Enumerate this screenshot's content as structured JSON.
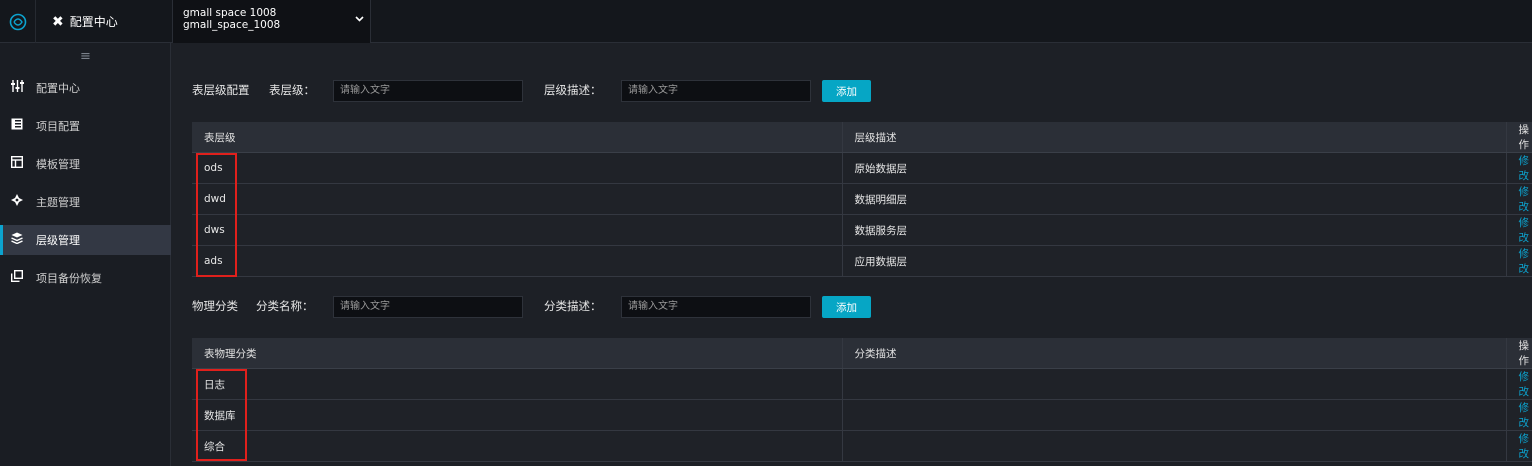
{
  "header": {
    "app_title": "配置中心",
    "space_name_display": "gmall space 1008",
    "space_name_id": "gmall_space_1008"
  },
  "sidebar": {
    "items": [
      {
        "label": "配置中心",
        "icon": "sliders-icon"
      },
      {
        "label": "项目配置",
        "icon": "book-icon"
      },
      {
        "label": "模板管理",
        "icon": "template-icon"
      },
      {
        "label": "主题管理",
        "icon": "compass-icon"
      },
      {
        "label": "层级管理",
        "icon": "layers-icon",
        "active": true
      },
      {
        "label": "项目备份恢复",
        "icon": "copy-icon"
      }
    ]
  },
  "layer_form": {
    "section_label": "表层级配置",
    "field1_label": "表层级：",
    "field1_placeholder": "请输入文字",
    "field2_label": "层级描述：",
    "field2_placeholder": "请输入文字",
    "add_label": "添加"
  },
  "layer_table": {
    "headers": [
      "表层级",
      "层级描述",
      "操作"
    ],
    "rows": [
      {
        "level": "ods",
        "desc": "原始数据层",
        "op": "修改"
      },
      {
        "level": "dwd",
        "desc": "数据明细层",
        "op": "修改"
      },
      {
        "level": "dws",
        "desc": "数据服务层",
        "op": "修改"
      },
      {
        "level": "ads",
        "desc": "应用数据层",
        "op": "修改"
      }
    ]
  },
  "category_form": {
    "section_label": "物理分类",
    "field1_label": "分类名称：",
    "field1_placeholder": "请输入文字",
    "field2_label": "分类描述：",
    "field2_placeholder": "请输入文字",
    "add_label": "添加"
  },
  "category_table": {
    "headers": [
      "表物理分类",
      "分类描述",
      "操作"
    ],
    "rows": [
      {
        "name": "日志",
        "desc": "",
        "op": "修改"
      },
      {
        "name": "数据库",
        "desc": "",
        "op": "修改"
      },
      {
        "name": "综合",
        "desc": "",
        "op": "修改"
      }
    ]
  },
  "colors": {
    "accent": "#06a6c5",
    "highlight": "#e0201c",
    "background": "#1d2026"
  }
}
